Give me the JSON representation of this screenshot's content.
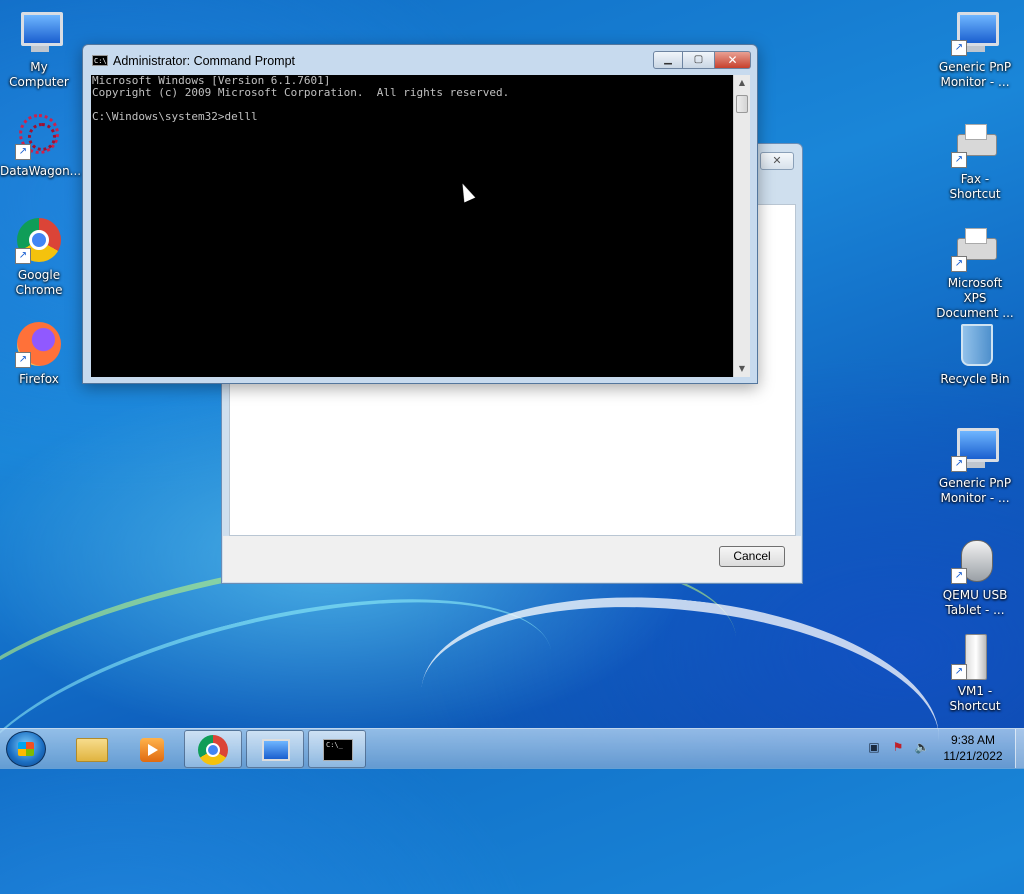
{
  "desktop": {
    "icons_left": [
      {
        "label": "My Computer",
        "icon": "computer-icon"
      },
      {
        "label": "DataWagon...",
        "icon": "datawagon-icon"
      },
      {
        "label": "Google Chrome",
        "icon": "chrome-icon"
      },
      {
        "label": "Firefox",
        "icon": "firefox-icon"
      }
    ],
    "icons_right": [
      {
        "label": "Generic PnP Monitor - ...",
        "icon": "monitor-icon"
      },
      {
        "label": "Fax - Shortcut",
        "icon": "fax-icon"
      },
      {
        "label": "Microsoft XPS Document ...",
        "icon": "printer-icon"
      },
      {
        "label": "Recycle Bin",
        "icon": "recycle-bin-icon"
      },
      {
        "label": "Generic PnP Monitor - ...",
        "icon": "monitor-icon"
      },
      {
        "label": "QEMU USB Tablet - ...",
        "icon": "mouse-icon"
      },
      {
        "label": "VM1 - Shortcut",
        "icon": "tower-icon"
      }
    ]
  },
  "background_dialog": {
    "close_glyph": "✕",
    "cancel_label": "Cancel"
  },
  "cmd_window": {
    "title": "Administrator: Command Prompt",
    "icon_text": "C:\\",
    "minimize_glyph": "▁",
    "maximize_glyph": "▢",
    "close_glyph": "✕",
    "console_lines": [
      "Microsoft Windows [Version 6.1.7601]",
      "Copyright (c) 2009 Microsoft Corporation.  All rights reserved.",
      "",
      "C:\\Windows\\system32>delll"
    ]
  },
  "taskbar": {
    "buttons": [
      {
        "name": "explorer",
        "icon": "folder-icon",
        "active": false
      },
      {
        "name": "media-player",
        "icon": "media-player-icon",
        "active": false
      },
      {
        "name": "chrome",
        "icon": "chrome-icon",
        "active": true
      },
      {
        "name": "remote-desktop",
        "icon": "remote-desktop-icon",
        "active": true
      },
      {
        "name": "command-prompt",
        "icon": "cmd-icon",
        "active": true,
        "icon_text": "C:\\_"
      }
    ],
    "tray": {
      "icons": [
        "network-icon",
        "action-center-icon",
        "volume-icon"
      ],
      "time": "9:38 AM",
      "date": "11/21/2022"
    }
  }
}
